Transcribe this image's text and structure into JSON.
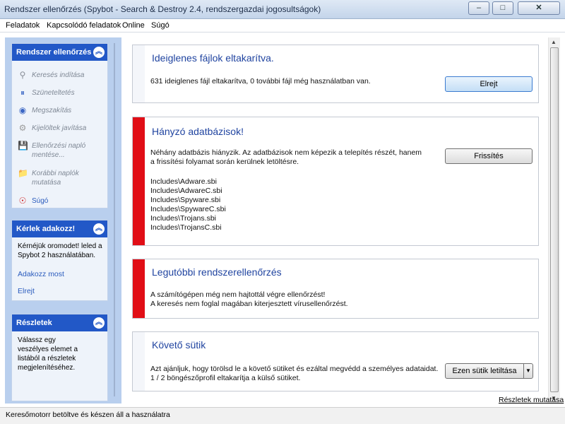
{
  "window": {
    "title": "Rendszer ellenőrzés (Spybot - Search & Destroy 2.4, rendszergazdai jogosultságok)",
    "minimize_label": "–",
    "maximize_label": "□",
    "close_label": "✕"
  },
  "menu": [
    "Feladatok",
    "Kapcsolódó feladatok",
    "Online",
    "Súgó"
  ],
  "sidebar": {
    "panel1": {
      "title": "Rendszer ellenőrzés",
      "items": [
        {
          "label": "Keresés indítása",
          "icon": "magnifier-icon"
        },
        {
          "label": "Szüneteltetés",
          "icon": "pause-icon"
        },
        {
          "label": "Megszakítás",
          "icon": "stop-icon"
        },
        {
          "label": "Kijelöltek javítása",
          "icon": "gear-fix-icon"
        },
        {
          "label": "Ellenőrzési napló mentése...",
          "icon": "save-icon"
        },
        {
          "label": "Korábbi naplók mutatása",
          "icon": "folder-icon"
        },
        {
          "label": "Súgó",
          "icon": "lifebuoy-icon"
        }
      ]
    },
    "panel2": {
      "title": "Kérlek adakozz!",
      "text": "Kérnéjük oromodet! leled a Spybot 2 használatában.",
      "link1": "Adakozz most",
      "link2": "Elrejt"
    },
    "panel3": {
      "title": "Részletek",
      "text": "Válassz egy veszélyes elemet a listából a részletek megjelenítéséhez."
    }
  },
  "cards": [
    {
      "title": "Ideiglenes fájlok eltakarítva.",
      "text": "631 ideiglenes fájl eltakarítva, 0 további fájl még használatban van.",
      "button": "Elrejt",
      "accent": "#f4f6fa"
    },
    {
      "title": "Hányzó adatbázisok!",
      "text": "Néhány adatbázis hiányzik. Az adatbázisok nem képezik a telepítés részét, hanem a frissítési folyamat során kerülnek letöltésre.",
      "files": [
        "Includes\\Adware.sbi",
        "Includes\\AdwareC.sbi",
        "Includes\\Spyware.sbi",
        "Includes\\SpywareC.sbi",
        "Includes\\Trojans.sbi",
        "Includes\\TrojansC.sbi"
      ],
      "button": "Frissítés",
      "accent": "#e10e16"
    },
    {
      "title": "Legutóbbi rendszerellenőrzés",
      "line1": "A számítógépen még nem hajtottál végre ellenőrzést!",
      "line2": "A keresés nem foglal magában kiterjesztett vírusellenőrzést.",
      "accent": "#e10e16"
    },
    {
      "title": "Követő sütik",
      "line1": "Azt ajánljuk, hogy törölsd le a követő sütiket és ezáltal megvédd a személyes adataidat.",
      "line2": "1 / 2 böngészőprofil eltakarítja a külső sütiket.",
      "button": "Ezen sütik letiltása",
      "accent": "#f4f6fa"
    }
  ],
  "details_link": "Részletek mutatása",
  "status": "Keresőmotorr betöltve és készen áll a használatra"
}
